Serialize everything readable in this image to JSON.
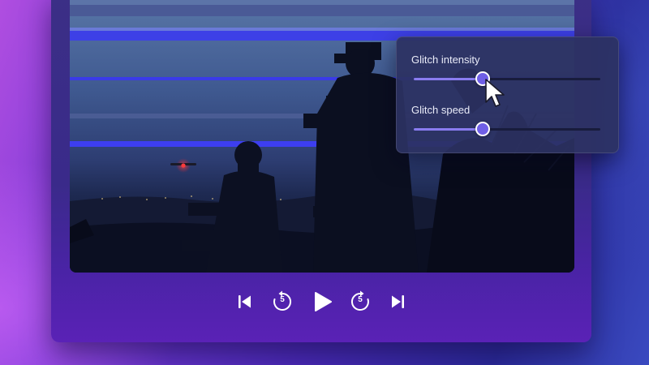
{
  "glitch_panel": {
    "intensity": {
      "label": "Glitch intensity",
      "value": 0.37
    },
    "speed": {
      "label": "Glitch speed",
      "value": 0.37
    }
  },
  "controls": {
    "skip_back_seconds": "5",
    "skip_forward_seconds": "5"
  },
  "icons": {
    "previous": "skip-to-start-icon",
    "rewind": "rewind-5-seconds-icon",
    "play": "play-icon",
    "forward": "forward-5-seconds-icon",
    "next": "skip-to-end-icon",
    "cursor": "mouse-pointer-icon"
  },
  "colors": {
    "slider_fill": "#8a7cf0",
    "slider_thumb": "#6f5fe6",
    "glitch_band": "#3c3cf0"
  }
}
